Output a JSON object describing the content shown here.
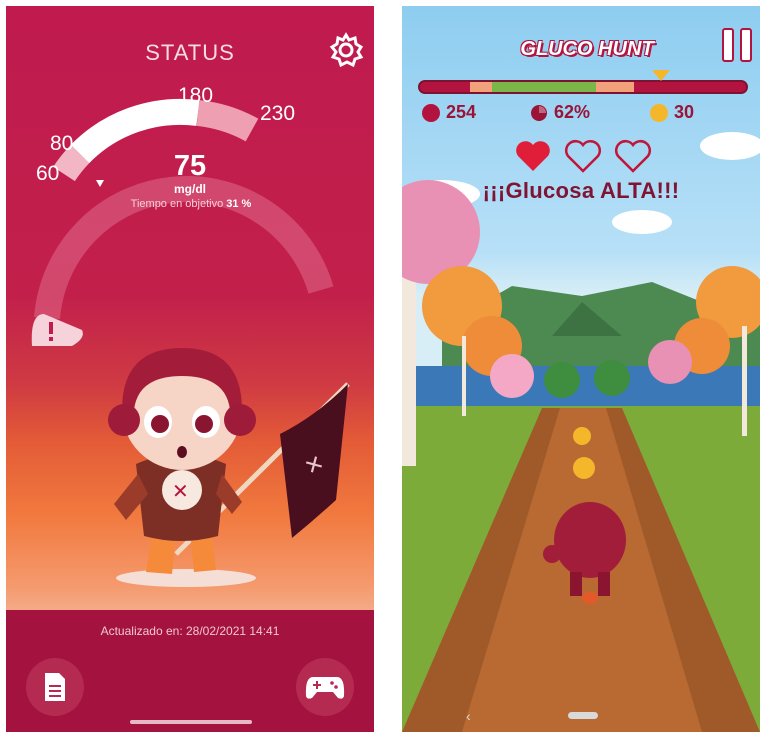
{
  "status_screen": {
    "title": "STATUS",
    "gauge": {
      "labels": {
        "l60": "60",
        "l80": "80",
        "l180": "180",
        "l230": "230"
      },
      "reading_value": "75",
      "reading_unit": "mg/dl",
      "time_in_range_label": "Tiempo en objetivo",
      "time_in_range_value": "31 %"
    },
    "updated_text": "Actualizado en: 28/02/2021 14:41",
    "icons": {
      "settings": "gear-icon",
      "warning": "warning-icon",
      "report": "document-icon",
      "game": "gamepad-icon"
    }
  },
  "game_screen": {
    "title": "GLUCO HUNT",
    "stats": {
      "glucose": "254",
      "time_percent": "62%",
      "coins": "30"
    },
    "hearts_filled": 1,
    "hearts_total": 3,
    "alert": "¡¡¡Glucosa ALTA!!!",
    "icons": {
      "pause": "pause-icon",
      "glucose": "glucose-drop-icon",
      "clock": "clock-icon",
      "coin": "coin-icon",
      "heart": "heart-icon",
      "back": "back-icon"
    }
  },
  "colors": {
    "brand_red": "#c01a4f",
    "dark_red": "#a4133f",
    "alert_text": "#7f1434",
    "gold": "#f4b62a"
  }
}
